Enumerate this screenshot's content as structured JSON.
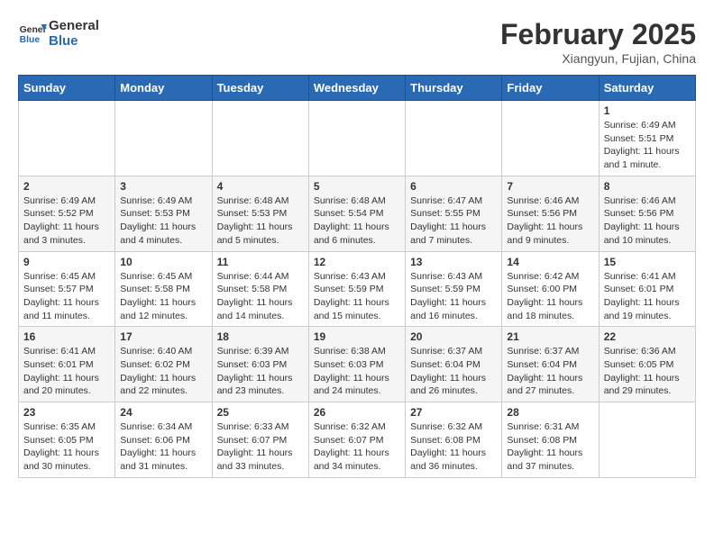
{
  "header": {
    "logo_line1": "General",
    "logo_line2": "Blue",
    "month": "February 2025",
    "location": "Xiangyun, Fujian, China"
  },
  "days_of_week": [
    "Sunday",
    "Monday",
    "Tuesday",
    "Wednesday",
    "Thursday",
    "Friday",
    "Saturday"
  ],
  "weeks": [
    [
      {
        "day": "",
        "info": ""
      },
      {
        "day": "",
        "info": ""
      },
      {
        "day": "",
        "info": ""
      },
      {
        "day": "",
        "info": ""
      },
      {
        "day": "",
        "info": ""
      },
      {
        "day": "",
        "info": ""
      },
      {
        "day": "1",
        "info": "Sunrise: 6:49 AM\nSunset: 5:51 PM\nDaylight: 11 hours\nand 1 minute."
      }
    ],
    [
      {
        "day": "2",
        "info": "Sunrise: 6:49 AM\nSunset: 5:52 PM\nDaylight: 11 hours\nand 3 minutes."
      },
      {
        "day": "3",
        "info": "Sunrise: 6:49 AM\nSunset: 5:53 PM\nDaylight: 11 hours\nand 4 minutes."
      },
      {
        "day": "4",
        "info": "Sunrise: 6:48 AM\nSunset: 5:53 PM\nDaylight: 11 hours\nand 5 minutes."
      },
      {
        "day": "5",
        "info": "Sunrise: 6:48 AM\nSunset: 5:54 PM\nDaylight: 11 hours\nand 6 minutes."
      },
      {
        "day": "6",
        "info": "Sunrise: 6:47 AM\nSunset: 5:55 PM\nDaylight: 11 hours\nand 7 minutes."
      },
      {
        "day": "7",
        "info": "Sunrise: 6:46 AM\nSunset: 5:56 PM\nDaylight: 11 hours\nand 9 minutes."
      },
      {
        "day": "8",
        "info": "Sunrise: 6:46 AM\nSunset: 5:56 PM\nDaylight: 11 hours\nand 10 minutes."
      }
    ],
    [
      {
        "day": "9",
        "info": "Sunrise: 6:45 AM\nSunset: 5:57 PM\nDaylight: 11 hours\nand 11 minutes."
      },
      {
        "day": "10",
        "info": "Sunrise: 6:45 AM\nSunset: 5:58 PM\nDaylight: 11 hours\nand 12 minutes."
      },
      {
        "day": "11",
        "info": "Sunrise: 6:44 AM\nSunset: 5:58 PM\nDaylight: 11 hours\nand 14 minutes."
      },
      {
        "day": "12",
        "info": "Sunrise: 6:43 AM\nSunset: 5:59 PM\nDaylight: 11 hours\nand 15 minutes."
      },
      {
        "day": "13",
        "info": "Sunrise: 6:43 AM\nSunset: 5:59 PM\nDaylight: 11 hours\nand 16 minutes."
      },
      {
        "day": "14",
        "info": "Sunrise: 6:42 AM\nSunset: 6:00 PM\nDaylight: 11 hours\nand 18 minutes."
      },
      {
        "day": "15",
        "info": "Sunrise: 6:41 AM\nSunset: 6:01 PM\nDaylight: 11 hours\nand 19 minutes."
      }
    ],
    [
      {
        "day": "16",
        "info": "Sunrise: 6:41 AM\nSunset: 6:01 PM\nDaylight: 11 hours\nand 20 minutes."
      },
      {
        "day": "17",
        "info": "Sunrise: 6:40 AM\nSunset: 6:02 PM\nDaylight: 11 hours\nand 22 minutes."
      },
      {
        "day": "18",
        "info": "Sunrise: 6:39 AM\nSunset: 6:03 PM\nDaylight: 11 hours\nand 23 minutes."
      },
      {
        "day": "19",
        "info": "Sunrise: 6:38 AM\nSunset: 6:03 PM\nDaylight: 11 hours\nand 24 minutes."
      },
      {
        "day": "20",
        "info": "Sunrise: 6:37 AM\nSunset: 6:04 PM\nDaylight: 11 hours\nand 26 minutes."
      },
      {
        "day": "21",
        "info": "Sunrise: 6:37 AM\nSunset: 6:04 PM\nDaylight: 11 hours\nand 27 minutes."
      },
      {
        "day": "22",
        "info": "Sunrise: 6:36 AM\nSunset: 6:05 PM\nDaylight: 11 hours\nand 29 minutes."
      }
    ],
    [
      {
        "day": "23",
        "info": "Sunrise: 6:35 AM\nSunset: 6:05 PM\nDaylight: 11 hours\nand 30 minutes."
      },
      {
        "day": "24",
        "info": "Sunrise: 6:34 AM\nSunset: 6:06 PM\nDaylight: 11 hours\nand 31 minutes."
      },
      {
        "day": "25",
        "info": "Sunrise: 6:33 AM\nSunset: 6:07 PM\nDaylight: 11 hours\nand 33 minutes."
      },
      {
        "day": "26",
        "info": "Sunrise: 6:32 AM\nSunset: 6:07 PM\nDaylight: 11 hours\nand 34 minutes."
      },
      {
        "day": "27",
        "info": "Sunrise: 6:32 AM\nSunset: 6:08 PM\nDaylight: 11 hours\nand 36 minutes."
      },
      {
        "day": "28",
        "info": "Sunrise: 6:31 AM\nSunset: 6:08 PM\nDaylight: 11 hours\nand 37 minutes."
      },
      {
        "day": "",
        "info": ""
      }
    ]
  ]
}
